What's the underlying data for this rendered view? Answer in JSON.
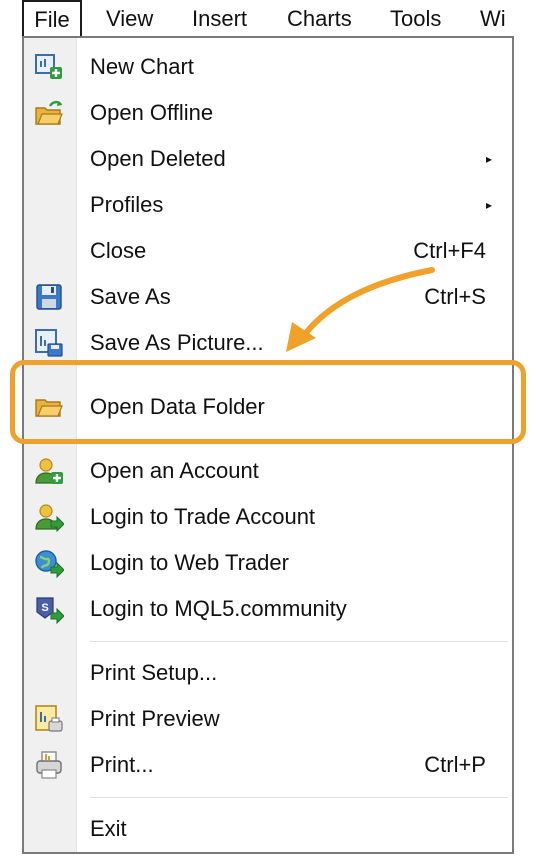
{
  "menubar": {
    "items": [
      "File",
      "View",
      "Insert",
      "Charts",
      "Tools",
      "Wi"
    ]
  },
  "menu": {
    "items": [
      {
        "label": "New Chart",
        "shortcut": "",
        "submenu": false,
        "icon": "new-chart-icon"
      },
      {
        "label": "Open Offline",
        "shortcut": "",
        "submenu": false,
        "icon": "open-offline-icon"
      },
      {
        "label": "Open Deleted",
        "shortcut": "",
        "submenu": true,
        "icon": ""
      },
      {
        "label": "Profiles",
        "shortcut": "",
        "submenu": true,
        "icon": ""
      },
      {
        "label": "Close",
        "shortcut": "Ctrl+F4",
        "submenu": false,
        "icon": ""
      },
      {
        "label": "Save As",
        "shortcut": "Ctrl+S",
        "submenu": false,
        "icon": "save-icon"
      },
      {
        "label": "Save As Picture...",
        "shortcut": "",
        "submenu": false,
        "icon": "save-picture-icon"
      },
      {
        "label": "Open Data Folder",
        "shortcut": "",
        "submenu": false,
        "icon": "folder-icon"
      },
      {
        "label": "Open an Account",
        "shortcut": "",
        "submenu": false,
        "icon": "open-account-icon"
      },
      {
        "label": "Login to Trade Account",
        "shortcut": "",
        "submenu": false,
        "icon": "login-trade-icon"
      },
      {
        "label": "Login to Web Trader",
        "shortcut": "",
        "submenu": false,
        "icon": "login-web-icon"
      },
      {
        "label": "Login to MQL5.community",
        "shortcut": "",
        "submenu": false,
        "icon": "login-mql5-icon"
      },
      {
        "label": "Print Setup...",
        "shortcut": "",
        "submenu": false,
        "icon": ""
      },
      {
        "label": "Print Preview",
        "shortcut": "",
        "submenu": false,
        "icon": "print-preview-icon"
      },
      {
        "label": "Print...",
        "shortcut": "Ctrl+P",
        "submenu": false,
        "icon": "print-icon"
      },
      {
        "label": "Exit",
        "shortcut": "",
        "submenu": false,
        "icon": ""
      }
    ],
    "submenu_glyph": "▸"
  },
  "annotation": {
    "color": "#f0a12a",
    "highlighted_item": "Open Data Folder"
  }
}
